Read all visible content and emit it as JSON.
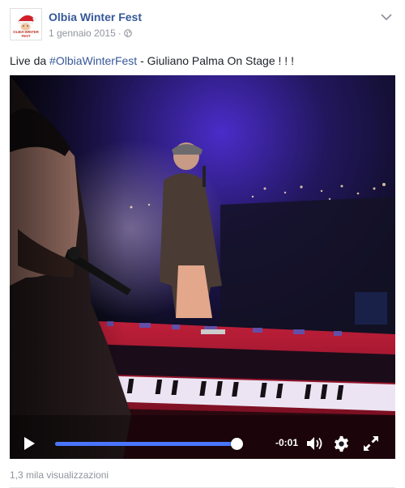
{
  "header": {
    "page_name": "Olbia Winter Fest",
    "date": "1 gennaio 2015",
    "separator": "·",
    "avatar_text": "OLBIA WINTER FEST"
  },
  "post": {
    "message_prefix": "Live da ",
    "hashtag": "#OlbiaWinterFest",
    "message_suffix": " - Giuliano Palma On Stage ! ! !"
  },
  "video": {
    "time_remaining": "-0:01",
    "progress": 0.99
  },
  "footer": {
    "views": "1,3 mila visualizzazioni"
  },
  "icons": {
    "privacy": "globe-icon",
    "menu": "chevron-down-icon",
    "play": "play-icon",
    "volume": "volume-icon",
    "settings": "gear-icon",
    "fullscreen": "fullscreen-icon"
  },
  "colors": {
    "link": "#365899",
    "meta": "#90949c",
    "progress": "#4a76ff"
  }
}
